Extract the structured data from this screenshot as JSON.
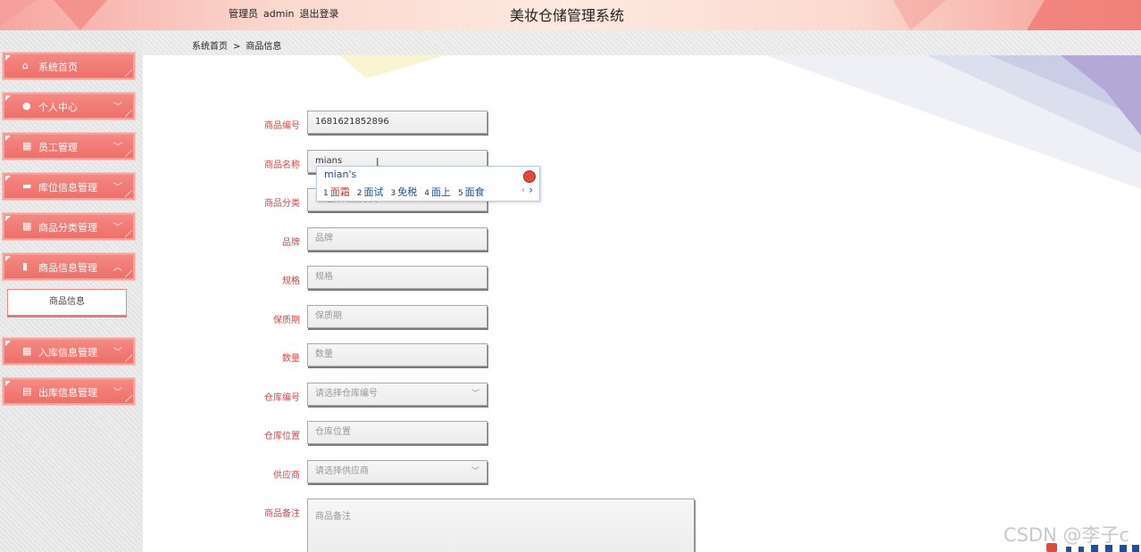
{
  "header": {
    "role": "管理员",
    "username": "admin",
    "logout": "退出登录",
    "title": "美妆仓储管理系统"
  },
  "sidebar": {
    "items": [
      {
        "label": "系统首页",
        "icon": "home-icon"
      },
      {
        "label": "个人中心",
        "icon": "user-icon"
      },
      {
        "label": "员工管理",
        "icon": "grid-icon"
      },
      {
        "label": "库位信息管理",
        "icon": "monitor-icon"
      },
      {
        "label": "商品分类管理",
        "icon": "grid-icon"
      },
      {
        "label": "商品信息管理",
        "icon": "clipboard-icon"
      },
      {
        "label": "入库信息管理",
        "icon": "grid-icon"
      },
      {
        "label": "出库信息管理",
        "icon": "table-icon"
      }
    ],
    "sub_items": [
      {
        "label": "商品信息"
      }
    ]
  },
  "breadcrumb": {
    "home": "系统首页",
    "separator": ">",
    "current": "商品信息"
  },
  "form": {
    "code": {
      "label": "商品编号",
      "value": "1681621852896"
    },
    "name": {
      "label": "商品名称",
      "value": "mians"
    },
    "category": {
      "label": "商品分类",
      "placeholder": "请选择商品分类"
    },
    "brand": {
      "label": "品牌",
      "placeholder": "品牌"
    },
    "spec": {
      "label": "规格",
      "placeholder": "规格"
    },
    "shelf_life": {
      "label": "保质期",
      "placeholder": "保质期"
    },
    "quantity": {
      "label": "数量",
      "placeholder": "数量"
    },
    "warehouse_no": {
      "label": "仓库编号",
      "placeholder": "请选择仓库编号"
    },
    "warehouse_loc": {
      "label": "仓库位置",
      "placeholder": "仓库位置"
    },
    "supplier": {
      "label": "供应商",
      "placeholder": "请选择供应商"
    },
    "remark": {
      "label": "商品备注",
      "placeholder": "商品备注"
    }
  },
  "ime": {
    "composition": "mian's",
    "candidates": [
      {
        "n": "1",
        "text": "面霜"
      },
      {
        "n": "2",
        "text": "面试"
      },
      {
        "n": "3",
        "text": "免税"
      },
      {
        "n": "4",
        "text": "面上"
      },
      {
        "n": "5",
        "text": "面食"
      }
    ],
    "prev": "‹",
    "next": "›"
  },
  "watermark": "CSDN @李子c",
  "colors": {
    "accent": "#ee6e68",
    "label_red": "#d04848"
  }
}
